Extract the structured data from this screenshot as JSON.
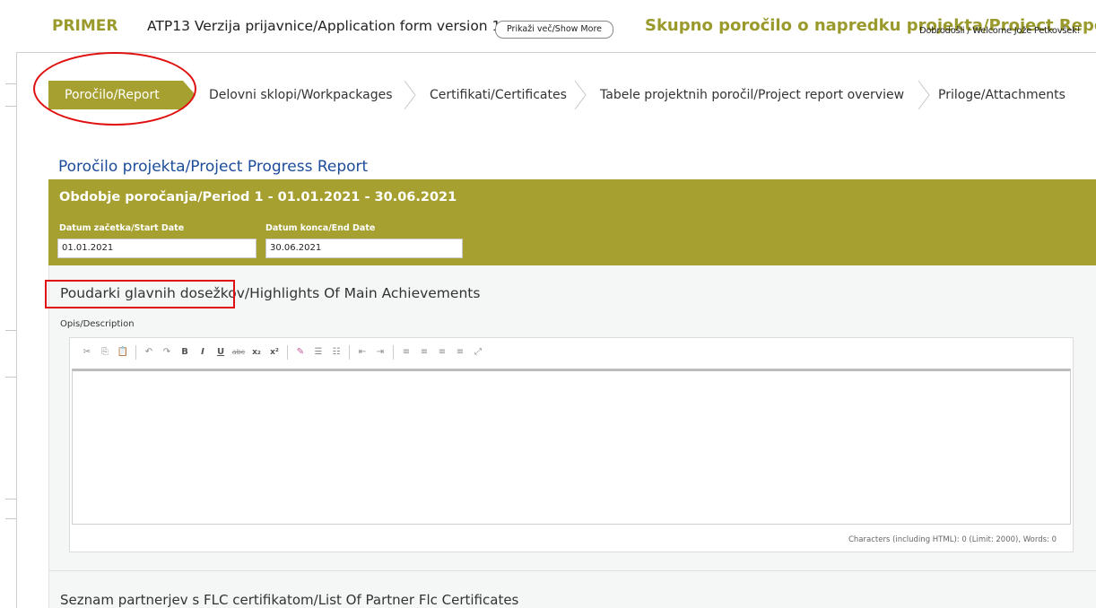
{
  "header": {
    "brand": "PRIMER",
    "form_version": "ATP13 Verzija prijavnice/Application form version 1",
    "show_more_label": "Prikaži več/Show More",
    "report_title": "Skupno poročilo o napredku projekta/Project Report",
    "welcome": "Dobrodošli / Welcome Jože Petkovšek!"
  },
  "tabs": [
    {
      "label": "Poročilo/Report",
      "active": true
    },
    {
      "label": "Delovni sklopi/Workpackages",
      "active": false
    },
    {
      "label": "Certifikati/Certificates",
      "active": false
    },
    {
      "label": "Tabele projektnih poročil/Project report overview",
      "active": false
    },
    {
      "label": "Priloge/Attachments",
      "active": false
    }
  ],
  "page_title": "Poročilo projekta/Project Progress Report",
  "period": {
    "title": "Obdobje poročanja/Period 1 - 01.01.2021 - 30.06.2021",
    "start_label": "Datum začetka/Start Date",
    "start_value": "01.01.2021",
    "end_label": "Datum konca/End Date",
    "end_value": "30.06.2021"
  },
  "highlights": {
    "title": "Poudarki glavnih dosežkov/Highlights Of Main Achievements",
    "description_label": "Opis/Description",
    "counter": "Characters (including HTML): 0 (Limit: 2000), Words: 0"
  },
  "toolbar": {
    "cut": "✂",
    "copy": "⎘",
    "paste": "📋",
    "undo": "↶",
    "redo": "↷",
    "bold": "B",
    "italic": "I",
    "underline": "U",
    "strike": "abc",
    "subscript": "x₂",
    "superscript": "x²",
    "format": "✎",
    "ordered_list": "☰",
    "bullet_list": "☷",
    "outdent": "⇤",
    "indent": "⇥",
    "align_left": "≡",
    "align_center": "≡",
    "align_right": "≡",
    "justify": "≡",
    "maximize": "⤢"
  },
  "partners_title": "Seznam partnerjev s FLC certifikatom/List Of Partner Flc Certificates",
  "colors": {
    "accent": "#a6a030",
    "brand_text": "#9a9a2c",
    "title_blue": "#1c4c9a",
    "annotation_red": "#e01010"
  }
}
